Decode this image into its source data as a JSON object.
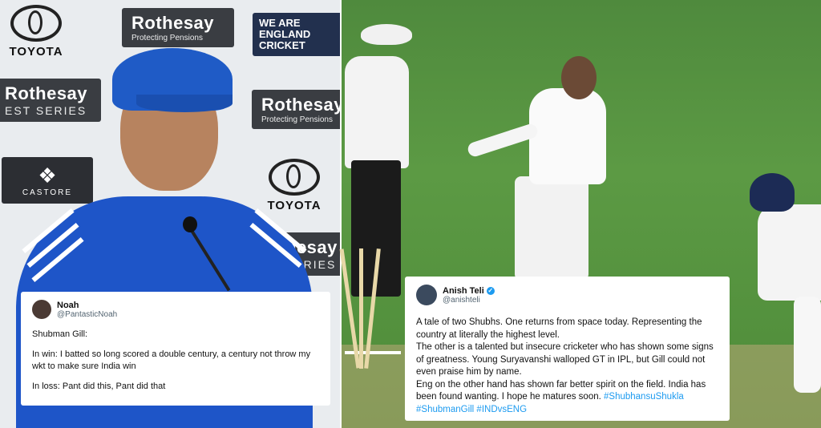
{
  "backdrop": {
    "toyota_top": "TOYOTA",
    "toyota_mid": "TOYOTA",
    "rothesay_1_title": "Rothesay",
    "rothesay_1_sub": "Protecting Pensions",
    "rothesay_2_title": "Rothesay",
    "rothesay_2_sub": "EST SERIES",
    "rothesay_3_title": "Rothesay",
    "rothesay_3_sub": "Protecting Pensions",
    "rothesay_4_title": "hesay",
    "rothesay_4_sub": "SERIES",
    "ecb_line1": "WE ARE",
    "ecb_line2": "ENGLAND",
    "ecb_line3": "CRICKET",
    "castore": "CASTORE"
  },
  "tweet_left": {
    "name": "Noah",
    "handle": "@PantasticNoah",
    "lines": [
      "Shubman Gill:",
      "In win: I batted so long scored a double century, a century not throw my wkt to make sure India win",
      "In loss: Pant did this, Pant did that"
    ]
  },
  "tweet_right": {
    "name": "Anish Teli",
    "handle": "@anishteli",
    "verified_icon": "✓",
    "paragraph1": "A tale of two Shubhs. One returns from space today. Representing the country at literally the highest level.",
    "paragraph2": "The other is a talented but insecure cricketer who has shown some signs of greatness. Young Suryavanshi walloped GT in IPL, but Gill could not even praise him by name.",
    "paragraph3": "Eng on the other hand has shown far better spirit on the field. India has been found wanting. I hope he matures soon.",
    "hashtags_inline": "#ShubhansuShukla",
    "hashtags_line": "#ShubmanGill #INDvsENG"
  },
  "colors": {
    "accent_link": "#1d9bf0",
    "jersey_blue": "#1e55c8",
    "pitch_green": "#5c9a44"
  }
}
